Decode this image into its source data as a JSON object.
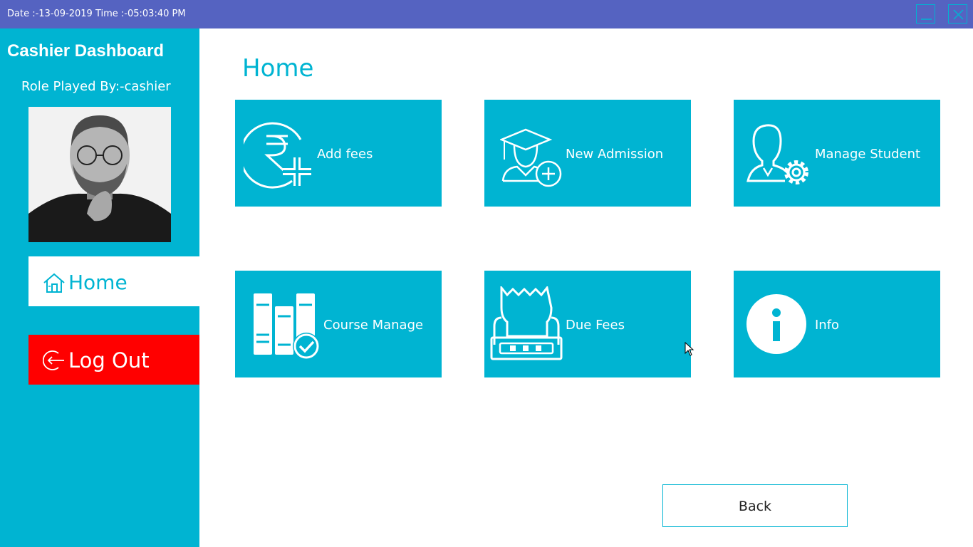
{
  "titlebar": {
    "datetime": "Date :-13-09-2019 Time :-05:03:40 PM",
    "background": "#5563c1",
    "minimize_icon": "minimize-icon",
    "close_icon": "close-icon"
  },
  "sidebar": {
    "title": "Cashier Dashboard",
    "role": "Role Played By:-cashier",
    "nav": {
      "home": {
        "label": "Home",
        "icon": "home-icon"
      },
      "logout": {
        "label": "Log Out",
        "icon": "logout-icon"
      }
    }
  },
  "main": {
    "title": "Home",
    "tiles": [
      {
        "label": "Add fees",
        "icon": "rupee-add-icon"
      },
      {
        "label": "New Admission",
        "icon": "graduate-add-icon"
      },
      {
        "label": "Manage Student",
        "icon": "user-gear-icon"
      },
      {
        "label": "Course Manage",
        "icon": "books-check-icon"
      },
      {
        "label": "Due Fees",
        "icon": "receipt-printer-icon"
      },
      {
        "label": "Info",
        "icon": "info-icon"
      }
    ],
    "back_label": "Back"
  },
  "colors": {
    "accent": "#00b4d2",
    "logout": "#ff0000",
    "titlebar": "#5563c1"
  }
}
